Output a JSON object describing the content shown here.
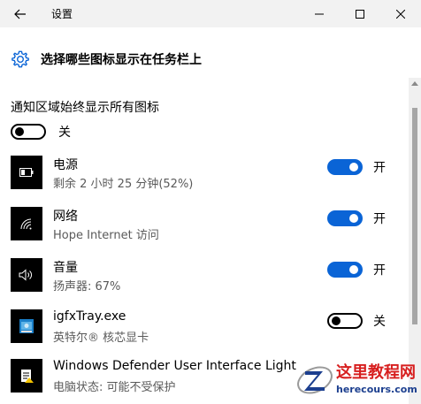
{
  "window": {
    "title": "设置"
  },
  "header": {
    "title": "选择哪些图标显示在任务栏上"
  },
  "always_show": {
    "label": "通知区域始终显示所有图标",
    "state_label": "关",
    "on": false
  },
  "items": [
    {
      "name": "电源",
      "sub": "剩余 2 小时 25 分钟(52%)",
      "state_label": "开",
      "on": true,
      "icon": "battery-icon"
    },
    {
      "name": "网络",
      "sub": "Hope Internet 访问",
      "state_label": "开",
      "on": true,
      "icon": "wifi-icon"
    },
    {
      "name": "音量",
      "sub": "扬声器: 67%",
      "state_label": "开",
      "on": true,
      "icon": "speaker-icon"
    },
    {
      "name": "igfxTray.exe",
      "sub": "英特尔® 核芯显卡",
      "state_label": "关",
      "on": false,
      "icon": "intel-graphics-icon"
    },
    {
      "name": "Windows Defender User Interface Light",
      "sub": "电脑状态: 可能不受保护",
      "state_label": "",
      "on": null,
      "icon": "defender-icon"
    }
  ],
  "watermark": {
    "title": "这里教程网",
    "url": "herecours.com"
  },
  "colors": {
    "accent": "#0a64d6",
    "titlebar": "#f2f2f2",
    "watermark_red": "#d71f1f",
    "watermark_blue": "#1c3f8f"
  }
}
